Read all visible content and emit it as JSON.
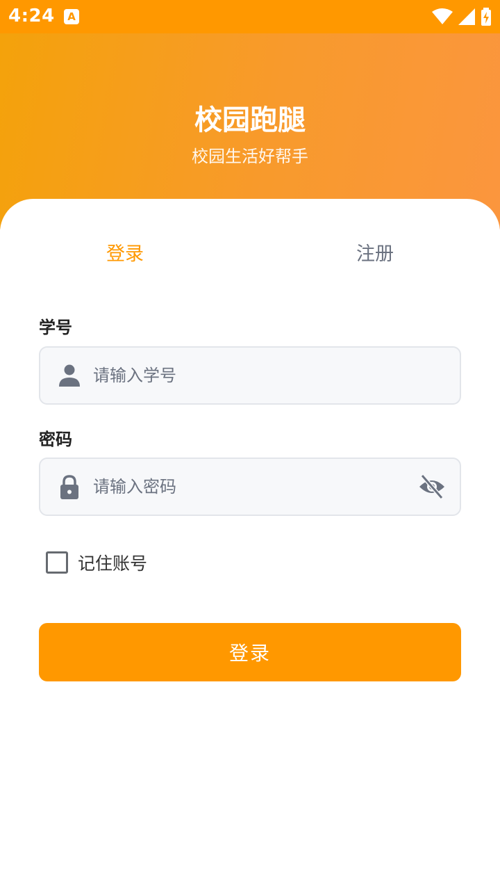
{
  "status_bar": {
    "time": "4:24",
    "app_icon_letter": "A"
  },
  "header": {
    "title": "校园跑腿",
    "subtitle": "校园生活好帮手"
  },
  "tabs": [
    {
      "label": "登录",
      "active": true
    },
    {
      "label": "注册",
      "active": false
    }
  ],
  "form": {
    "student_id": {
      "label": "学号",
      "placeholder": "请输入学号",
      "icon": "person-icon"
    },
    "password": {
      "label": "密码",
      "placeholder": "请输入密码",
      "icon": "lock-icon",
      "toggle_icon": "eye-off-icon"
    },
    "remember_label": "记住账号",
    "remember_checked": false,
    "submit_label": "登录"
  },
  "colors": {
    "accent": "#ff9800",
    "tab_inactive": "#6b7280",
    "icon_gray": "#6b7280"
  }
}
